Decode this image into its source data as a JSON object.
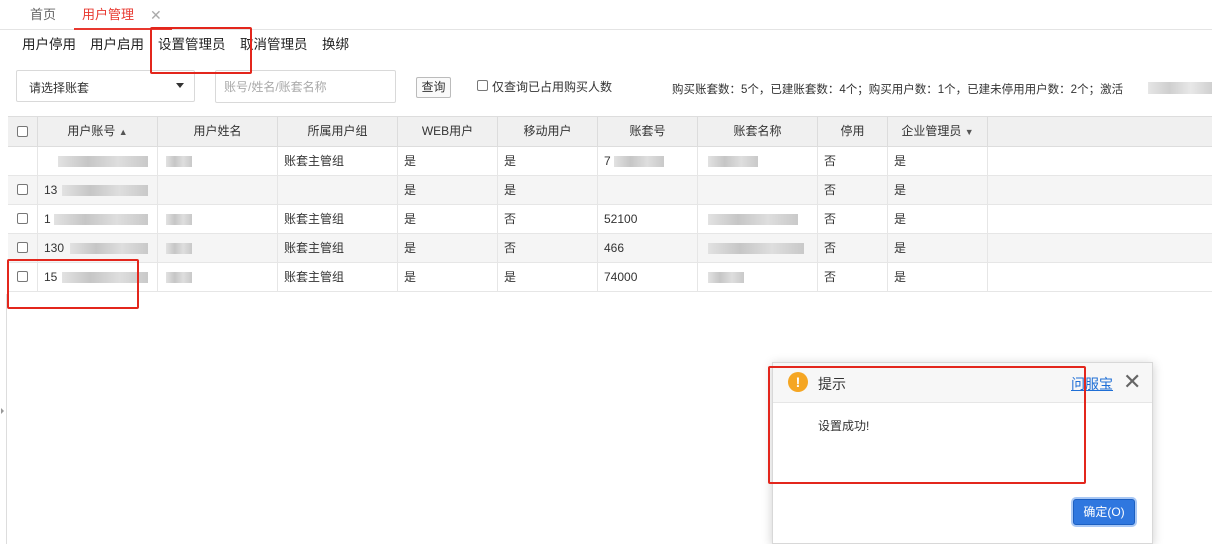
{
  "tabs": {
    "home": "首页",
    "current": "用户管理",
    "close_glyph": "✕"
  },
  "menu": [
    "用户停用",
    "用户启用",
    "设置管理员",
    "取消管理员",
    "换绑"
  ],
  "filter": {
    "select_value": "请选择账套",
    "search_placeholder": "账号/姓名/账套名称",
    "query_label": "查询",
    "checkbox_label": "仅查询已占用购买人数",
    "stats": "购买账套数：5个，已建账套数：4个；购买用户数：1个，已建未停用用户数：2个；激活"
  },
  "grid": {
    "headers": [
      "",
      "用户账号",
      "用户姓名",
      "所属用户组",
      "WEB用户",
      "移动用户",
      "账套号",
      "账套名称",
      "停用",
      "企业管理员"
    ],
    "sort_asc_glyph": "▲",
    "sort_desc_glyph": "▼",
    "rows": [
      {
        "account": "",
        "name": "",
        "group": "账套主管组",
        "web": "是",
        "mobile": "是",
        "set_no": "7",
        "set_name": "",
        "disabled": "否",
        "admin": "是"
      },
      {
        "account": "13",
        "name": "",
        "group": "",
        "web": "是",
        "mobile": "是",
        "set_no": "",
        "set_name": "",
        "disabled": "否",
        "admin": "是"
      },
      {
        "account": "1",
        "name": "",
        "group": "账套主管组",
        "web": "是",
        "mobile": "否",
        "set_no": "52100",
        "set_name": "",
        "disabled": "否",
        "admin": "是"
      },
      {
        "account": "130",
        "name": "",
        "group": "账套主管组",
        "web": "是",
        "mobile": "否",
        "set_no": "466",
        "set_name": "",
        "disabled": "否",
        "admin": "是"
      },
      {
        "account": "15",
        "name": "",
        "group": "账套主管组",
        "web": "是",
        "mobile": "是",
        "set_no": "74000",
        "set_name": "",
        "disabled": "否",
        "admin": "是"
      }
    ]
  },
  "dialog": {
    "icon_glyph": "!",
    "title": "提示",
    "link": "问服宝",
    "close_glyph": "✕",
    "message": "设置成功!",
    "ok_label": "确定(O)"
  },
  "colors": {
    "accent": "#e8382f",
    "annotation": "#e3261c",
    "primary_button": "#2f77df",
    "warning": "#f5a623"
  },
  "icons": [
    "close-icon",
    "dropdown-arrow-icon",
    "sort-asc-icon",
    "sort-desc-icon",
    "warning-icon",
    "dialog-close-icon"
  ]
}
